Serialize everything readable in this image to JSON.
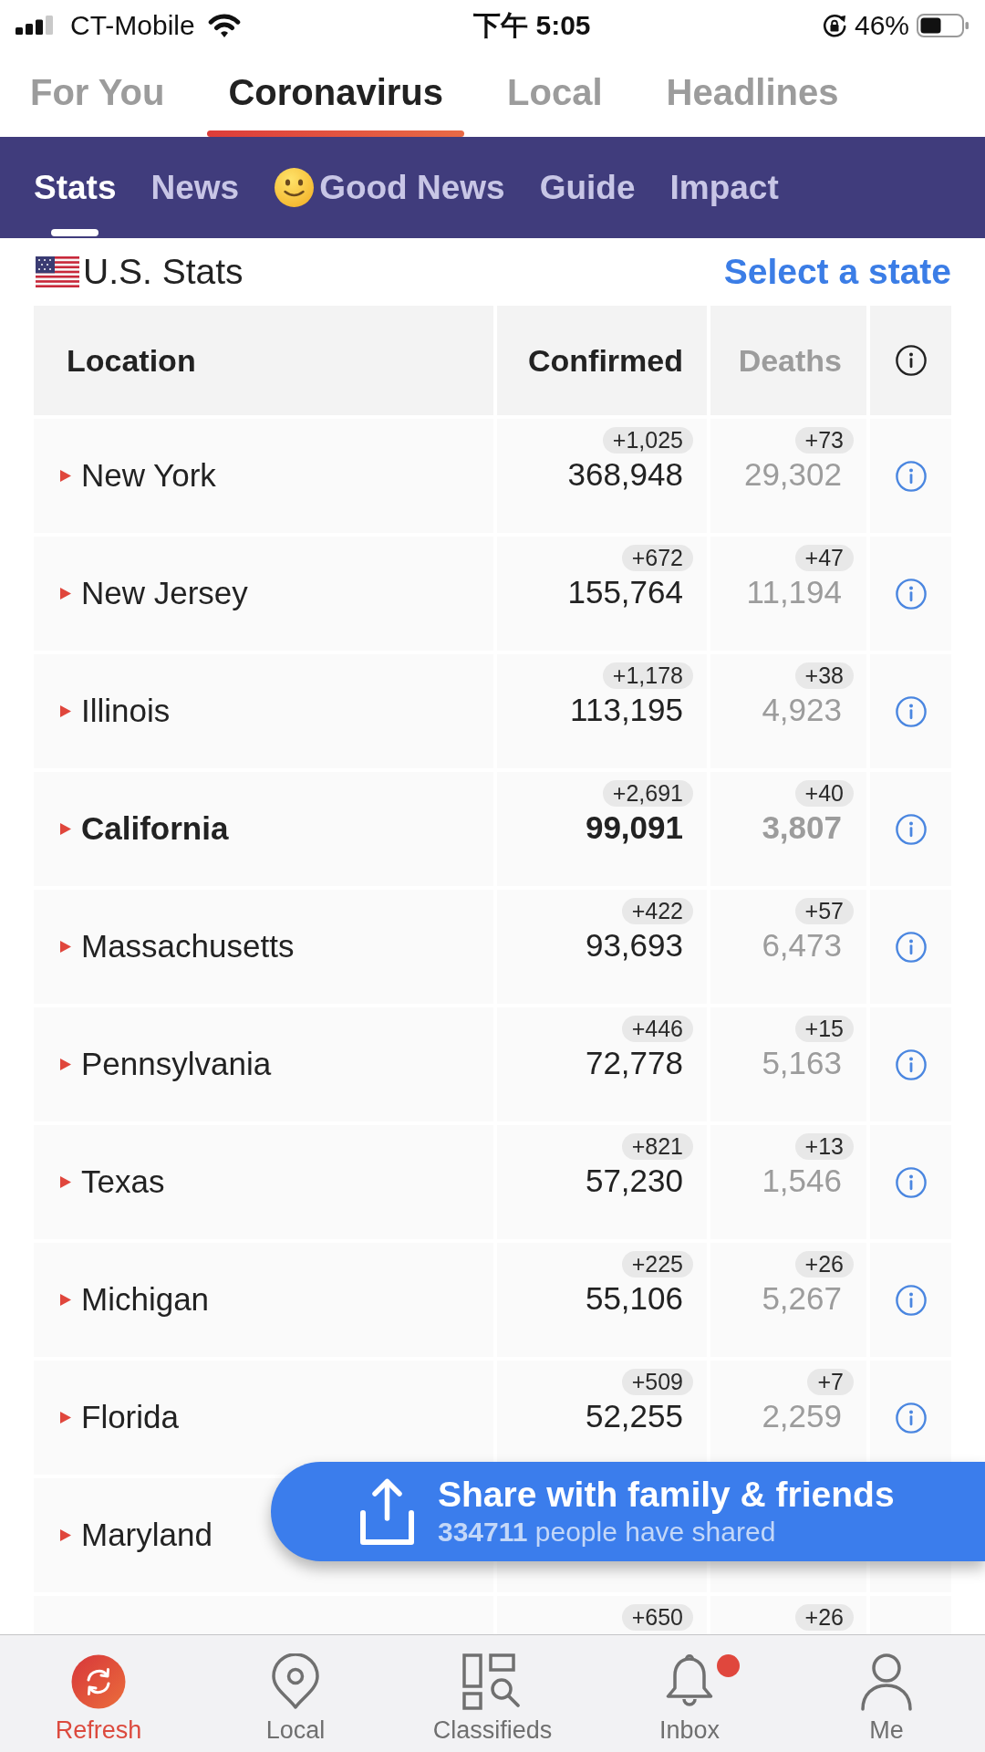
{
  "status_bar": {
    "carrier": "CT-Mobile",
    "time": "下午 5:05",
    "battery": "46%"
  },
  "top_tabs": [
    {
      "label": "For You",
      "selected": false
    },
    {
      "label": "Coronavirus",
      "selected": true
    },
    {
      "label": "Local",
      "selected": false
    },
    {
      "label": "Headlines",
      "selected": false
    }
  ],
  "sub_tabs": [
    {
      "label": "Stats",
      "selected": true,
      "icon": false
    },
    {
      "label": "News",
      "selected": false,
      "icon": false
    },
    {
      "label": "Good News",
      "selected": false,
      "icon": true
    },
    {
      "label": "Guide",
      "selected": false,
      "icon": false
    },
    {
      "label": "Impact",
      "selected": false,
      "icon": false
    }
  ],
  "section": {
    "title": "U.S. Stats",
    "link": "Select a state"
  },
  "table": {
    "columns": [
      {
        "label": "Location",
        "kind": "location"
      },
      {
        "label": "Confirmed",
        "kind": "confirmed"
      },
      {
        "label": "Deaths",
        "kind": "deaths"
      },
      {
        "kind": "info"
      }
    ],
    "rows": [
      {
        "location": "New York",
        "highlighted": false,
        "confirmed": {
          "change": "+1,025",
          "total": "368,948"
        },
        "deaths": {
          "change": "+73",
          "total": "29,302"
        }
      },
      {
        "location": "New Jersey",
        "highlighted": false,
        "confirmed": {
          "change": "+672",
          "total": "155,764"
        },
        "deaths": {
          "change": "+47",
          "total": "11,194"
        }
      },
      {
        "location": "Illinois",
        "highlighted": false,
        "confirmed": {
          "change": "+1,178",
          "total": "113,195"
        },
        "deaths": {
          "change": "+38",
          "total": "4,923"
        }
      },
      {
        "location": "California",
        "highlighted": true,
        "confirmed": {
          "change": "+2,691",
          "total": "99,091"
        },
        "deaths": {
          "change": "+40",
          "total": "3,807"
        }
      },
      {
        "location": "Massachusetts",
        "highlighted": false,
        "confirmed": {
          "change": "+422",
          "total": "93,693"
        },
        "deaths": {
          "change": "+57",
          "total": "6,473"
        }
      },
      {
        "location": "Pennsylvania",
        "highlighted": false,
        "confirmed": {
          "change": "+446",
          "total": "72,778"
        },
        "deaths": {
          "change": "+15",
          "total": "5,163"
        }
      },
      {
        "location": "Texas",
        "highlighted": false,
        "confirmed": {
          "change": "+821",
          "total": "57,230"
        },
        "deaths": {
          "change": "+13",
          "total": "1,546"
        }
      },
      {
        "location": "Michigan",
        "highlighted": false,
        "confirmed": {
          "change": "+225",
          "total": "55,106"
        },
        "deaths": {
          "change": "+26",
          "total": "5,267"
        }
      },
      {
        "location": "Florida",
        "highlighted": false,
        "confirmed": {
          "change": "+509",
          "total": "52,255"
        },
        "deaths": {
          "change": "+7",
          "total": "2,259"
        }
      },
      {
        "location": "Maryland",
        "highlighted": false
      },
      {
        "confirmed": {
          "change": "+650"
        },
        "deaths": {
          "change": "+26"
        }
      }
    ]
  },
  "share_banner": {
    "title": "Share with family & friends",
    "subtitle": "**334711** people have shared"
  },
  "bottom_nav": [
    {
      "label": "Refresh",
      "kind": "refresh",
      "selected": true,
      "notification": false
    },
    {
      "label": "Local",
      "kind": "local",
      "selected": false,
      "notification": false
    },
    {
      "label": "Classifieds",
      "kind": "classifieds",
      "selected": false,
      "notification": false
    },
    {
      "label": "Inbox",
      "kind": "inbox",
      "selected": false,
      "notification": true
    },
    {
      "label": "Me",
      "kind": "me",
      "selected": false,
      "notification": false
    }
  ]
}
